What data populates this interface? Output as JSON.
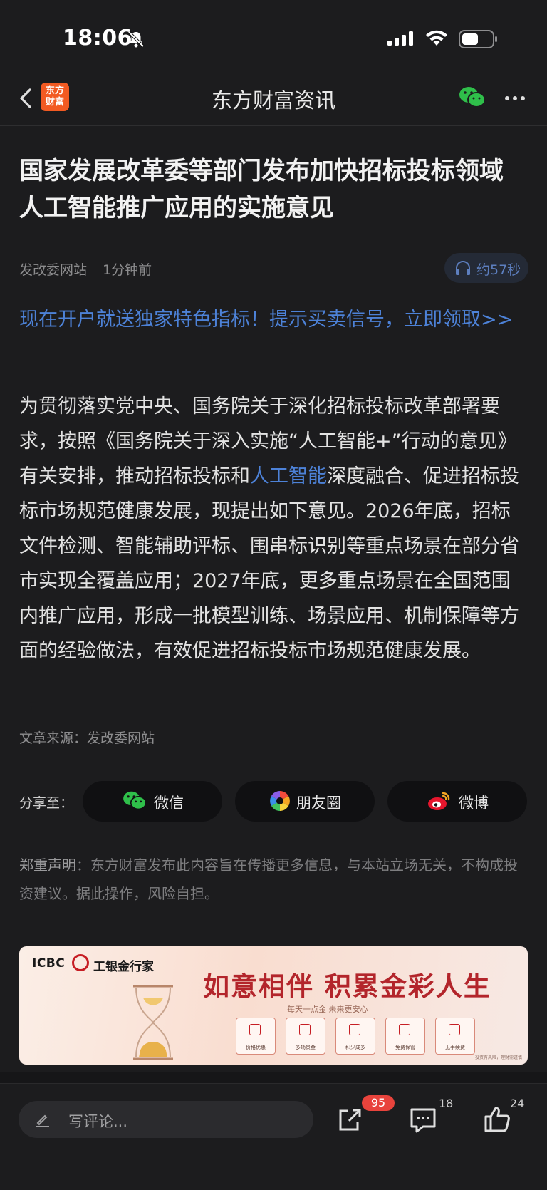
{
  "status": {
    "time": "18:06"
  },
  "nav": {
    "logo_line1": "东方",
    "logo_line2": "财富",
    "title": "东方财富资讯"
  },
  "article": {
    "title": "国家发展改革委等部门发布加快招标投标领域人工智能推广应用的实施意见",
    "source_name": "发改委网站",
    "time_ago": "1分钟前",
    "audio_length": "约57秒",
    "promo": "现在开户就送独家特色指标！提示买卖信号，立即领取>>",
    "body_part1": "为贯彻落实党中央、国务院关于深化招标投标改革部署要求，按照《国务院关于深入实施“人工智能+”行动的意见》有关安排，推动招标投标和",
    "body_link": "人工智能",
    "body_part2": "深度融合、促进招标投标市场规范健康发展，现提出如下意见。2026年底，招标文件检测、智能辅助评标、围串标识别等重点场景在部分省市实现全覆盖应用；2027年底，更多重点场景在全国范围内推广应用，形成一批模型训练、场景应用、机制保障等方面的经验做法，有效促进招标投标市场规范健康发展。",
    "source_line": "文章来源：发改委网站"
  },
  "share": {
    "label": "分享至：",
    "wechat": "微信",
    "moments": "朋友圈",
    "weibo": "微博"
  },
  "disclaimer": {
    "heading": "郑重声明",
    "text": "：东方财富发布此内容旨在传播更多信息，与本站立场无关，不构成投资建议。据此操作，风险自担。"
  },
  "ad": {
    "bank": "ICBC",
    "brand": "工银金行家",
    "slogan": "如意相伴 积累金彩人生",
    "sub": "每天一点金  未来更安心",
    "features": [
      "价格优惠",
      "多场景金",
      "积少成多",
      "免费保管",
      "无手续费"
    ],
    "fine_print": "投资有风险，理财需谨慎"
  },
  "bottom": {
    "comment_placeholder": "写评论...",
    "share_count": "95",
    "comment_count": "18",
    "like_count": "24"
  },
  "colors": {
    "accent_link": "#4d82d8",
    "logo_orange": "#f25a22",
    "badge_red": "#e8433c"
  }
}
